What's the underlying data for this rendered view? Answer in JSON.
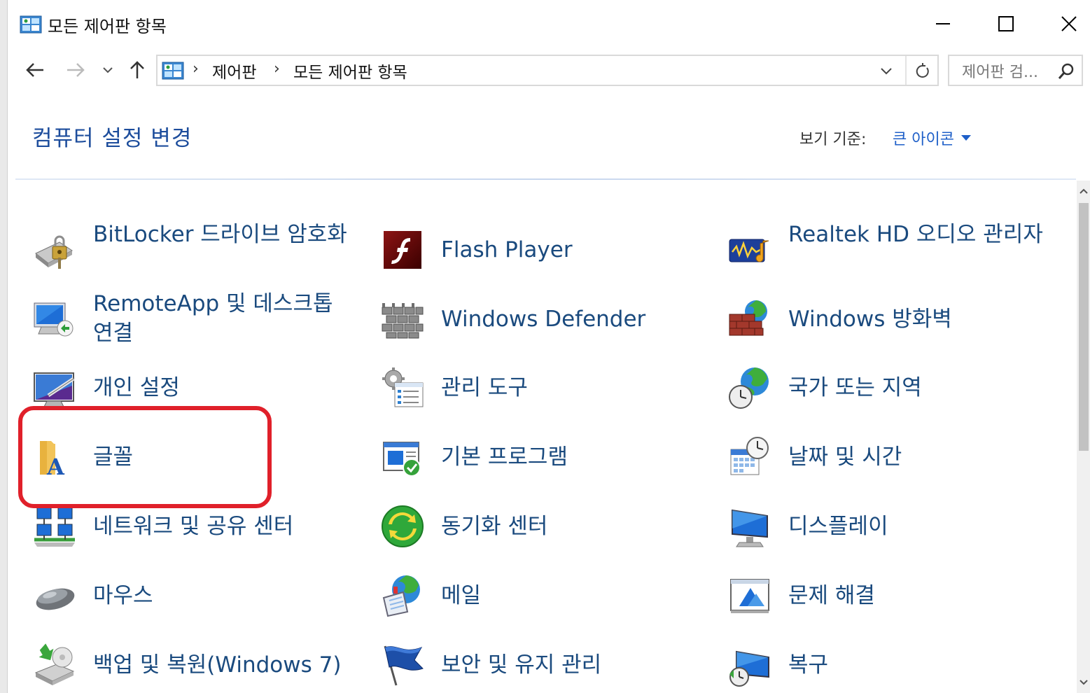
{
  "window": {
    "title": "모든 제어판 항목"
  },
  "nav": {
    "breadcrumb": [
      "제어판",
      "모든 제어판 항목"
    ],
    "search_placeholder": "제어판 검..."
  },
  "header": {
    "title": "컴퓨터 설정 변경",
    "view_by_label": "보기 기준:",
    "view_by_value": "큰 아이콘"
  },
  "items": [
    {
      "label": "BitLocker 드라이브 암호화",
      "icon": "bitlocker-icon"
    },
    {
      "label": "Flash Player",
      "icon": "flash-player-icon"
    },
    {
      "label": "Realtek HD 오디오 관리자",
      "icon": "realtek-audio-icon"
    },
    {
      "label": "RemoteApp 및 데스크톱 연결",
      "icon": "remoteapp-icon"
    },
    {
      "label": "Windows Defender",
      "icon": "windows-defender-icon"
    },
    {
      "label": "Windows 방화벽",
      "icon": "firewall-icon"
    },
    {
      "label": "개인 설정",
      "icon": "personalization-icon"
    },
    {
      "label": "관리 도구",
      "icon": "admin-tools-icon"
    },
    {
      "label": "국가 또는 지역",
      "icon": "region-icon"
    },
    {
      "label": "글꼴",
      "icon": "fonts-icon"
    },
    {
      "label": "기본 프로그램",
      "icon": "default-programs-icon"
    },
    {
      "label": "날짜 및 시간",
      "icon": "date-time-icon"
    },
    {
      "label": "네트워크 및 공유 센터",
      "icon": "network-icon"
    },
    {
      "label": "동기화 센터",
      "icon": "sync-center-icon"
    },
    {
      "label": "디스플레이",
      "icon": "display-icon"
    },
    {
      "label": "마우스",
      "icon": "mouse-icon"
    },
    {
      "label": "메일",
      "icon": "mail-icon"
    },
    {
      "label": "문제 해결",
      "icon": "troubleshooting-icon"
    },
    {
      "label": "백업 및 복원(Windows 7)",
      "icon": "backup-restore-icon"
    },
    {
      "label": "보안 및 유지 관리",
      "icon": "security-maintenance-icon"
    },
    {
      "label": "복구",
      "icon": "recovery-icon"
    }
  ],
  "colors": {
    "link": "#1a4a7e",
    "title": "#1d4d9c",
    "highlight": "#e0202a"
  }
}
